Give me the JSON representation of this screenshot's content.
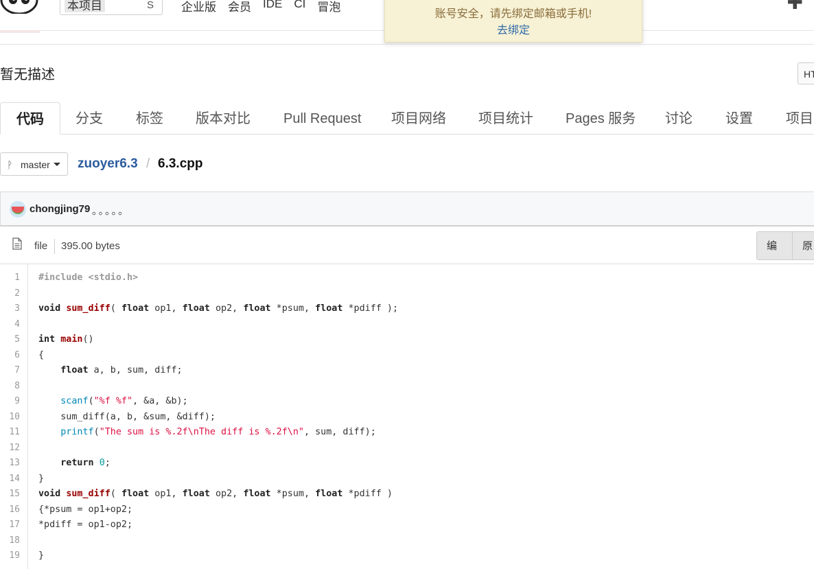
{
  "topnav": {
    "search_scope": "本项目",
    "search_shortcut": "S",
    "links": [
      "企业版",
      "会员",
      "IDE",
      "CI",
      "冒泡"
    ]
  },
  "notice": {
    "message": "账号安全，请先绑定邮箱或手机!",
    "action": "去绑定"
  },
  "project": {
    "description": "暂无描述",
    "clone_button": "HT"
  },
  "tabs": [
    "代码",
    "分支",
    "标签",
    "版本对比",
    "Pull Request",
    "项目网络",
    "项目统计",
    "Pages 服务",
    "讨论",
    "设置",
    "项目"
  ],
  "branch": {
    "name": "master"
  },
  "breadcrumb": {
    "repo": "zuoyer6.3",
    "separator": "/",
    "file": "6.3.cpp"
  },
  "commit": {
    "author": "chongjing79",
    "message": "。。。。。"
  },
  "file": {
    "type": "file",
    "size": "395.00 bytes",
    "actions": [
      "编辑",
      "原"
    ]
  },
  "code": {
    "line_numbers": [
      "1",
      "2",
      "3",
      "4",
      "5",
      "6",
      "7",
      "8",
      "9",
      "10",
      "11",
      "12",
      "13",
      "14",
      "15",
      "16",
      "17",
      "18",
      "19"
    ]
  },
  "colors": {
    "accent_link": "#2b5b9e",
    "notice_bg": "#f7f1d5",
    "keyword_fn": "#990000",
    "string": "#dd1144"
  }
}
